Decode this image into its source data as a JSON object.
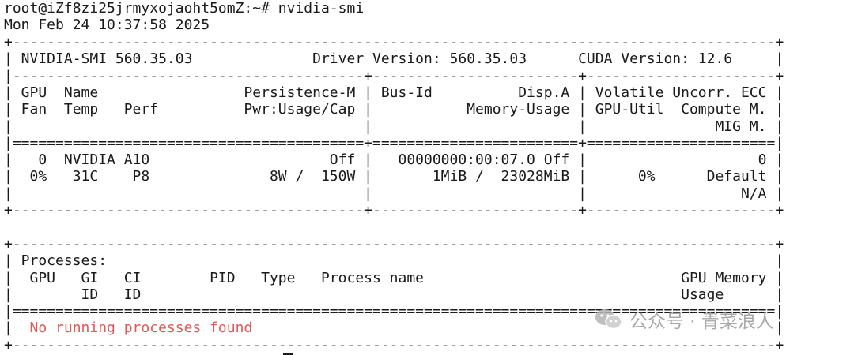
{
  "terminal": {
    "prompt_line": "root@iZf8zi25jrmyxojaoht5omZ:~# nvidia-smi",
    "date_line": "Mon Feb 24 10:37:58 2025",
    "gpu_table": {
      "border": "+-----------------------------------------------------------------------------------------+",
      "header": "| NVIDIA-SMI 560.35.03              Driver Version: 560.35.03      CUDA Version: 12.6     |",
      "sep": "|-----------------------------------------+------------------------+----------------------+",
      "col_header_1": "| GPU  Name                 Persistence-M | Bus-Id          Disp.A | Volatile Uncorr. ECC |",
      "col_header_2": "| Fan  Temp   Perf          Pwr:Usage/Cap |           Memory-Usage | GPU-Util  Compute M. |",
      "col_header_3": "|                                         |                        |               MIG M. |",
      "double_sep": "|=========================================+========================+======================|",
      "gpu_row_1": "|   0  NVIDIA A10                     Off |   00000000:00:07.0 Off |                    0 |",
      "gpu_row_2": "|  0%   31C    P8              8W /  150W |       1MiB /  23028MiB |      0%      Default |",
      "gpu_row_3": "|                                         |                        |                  N/A |",
      "bottom_border": "+-----------------------------------------+------------------------+----------------------+"
    },
    "process_table": {
      "border": "+-----------------------------------------------------------------------------------------+",
      "title": "| Processes:                                                                              |",
      "col_header_1": "|  GPU   GI   CI        PID   Type   Process name                              GPU Memory |",
      "col_header_2": "|        ID   ID                                                               Usage      |",
      "double_sep": "|=========================================================================================|",
      "empty_row_left": "|  ",
      "empty_message": "No running processes found",
      "empty_row_right": "                                                             |",
      "bottom_border": "+-----------------------------------------------------------------------------------------+"
    }
  },
  "watermark": {
    "text": "公众号 · 青菜浪人",
    "icon": "wechat-icon"
  },
  "colors": {
    "text": "#1a1a1a",
    "error": "#e05a5a",
    "watermark": "#9a9a9a",
    "background": "#ffffff"
  }
}
